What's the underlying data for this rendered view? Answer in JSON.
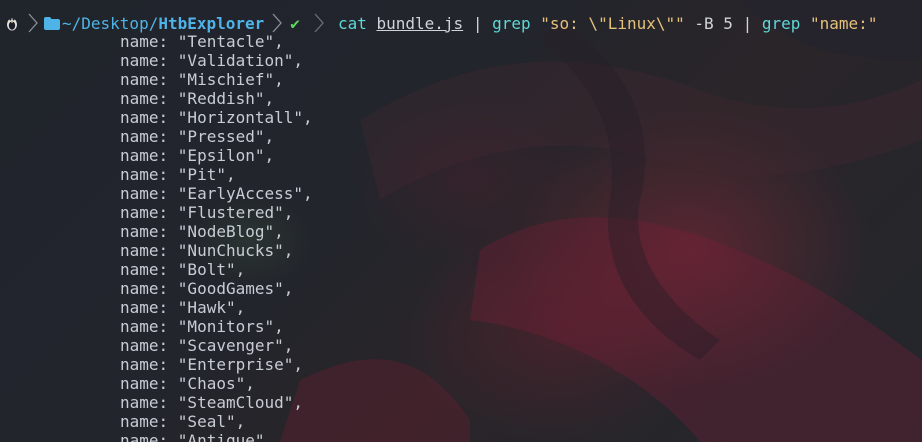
{
  "prompt": {
    "os_icon": "linux-penguin-icon",
    "folder_icon": "folder-icon",
    "path_prefix": "~/Desktop/",
    "path_current": "HtbExplorer",
    "status_icon": "check-icon",
    "status_symbol": "✔",
    "colors": {
      "path": "#4fb3e8",
      "command": "#5fd7d7",
      "status_ok": "#5fd75f",
      "string": "#e5c07b"
    }
  },
  "command": {
    "program": "cat",
    "file": "bundle.js",
    "pipe1": " | ",
    "grep1": "grep",
    "grep1_pattern": "\"so: \\\"Linux\\\"\"",
    "grep1_flag": " -B 5",
    "pipe2": " | ",
    "grep2": "grep",
    "grep2_pattern": "\"name:\""
  },
  "output": {
    "key": "name: ",
    "lines": [
      "\"Tentacle\",",
      "\"Validation\",",
      "\"Mischief\",",
      "\"Reddish\",",
      "\"Horizontall\",",
      "\"Pressed\",",
      "\"Epsilon\",",
      "\"Pit\",",
      "\"EarlyAccess\",",
      "\"Flustered\",",
      "\"NodeBlog\",",
      "\"NunChucks\",",
      "\"Bolt\",",
      "\"GoodGames\",",
      "\"Hawk\",",
      "\"Monitors\",",
      "\"Scavenger\",",
      "\"Enterprise\",",
      "\"Chaos\",",
      "\"SteamCloud\",",
      "\"Seal\",",
      "\"Antique\","
    ]
  }
}
